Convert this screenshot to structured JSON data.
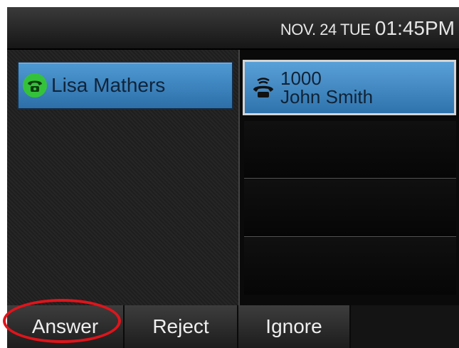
{
  "status_bar": {
    "date": "NOV. 24 TUE",
    "time": "01:45PM"
  },
  "line_key": {
    "label": "Lisa Mathers",
    "icon": "line-presence-icon",
    "icon_color": "#34c23a"
  },
  "incoming_call": {
    "number": "1000",
    "name": "John Smith",
    "icon": "phone-ringing-icon"
  },
  "softkeys": [
    {
      "label": "Answer"
    },
    {
      "label": "Reject"
    },
    {
      "label": "Ignore"
    }
  ],
  "annotation_color": "#e0141b"
}
